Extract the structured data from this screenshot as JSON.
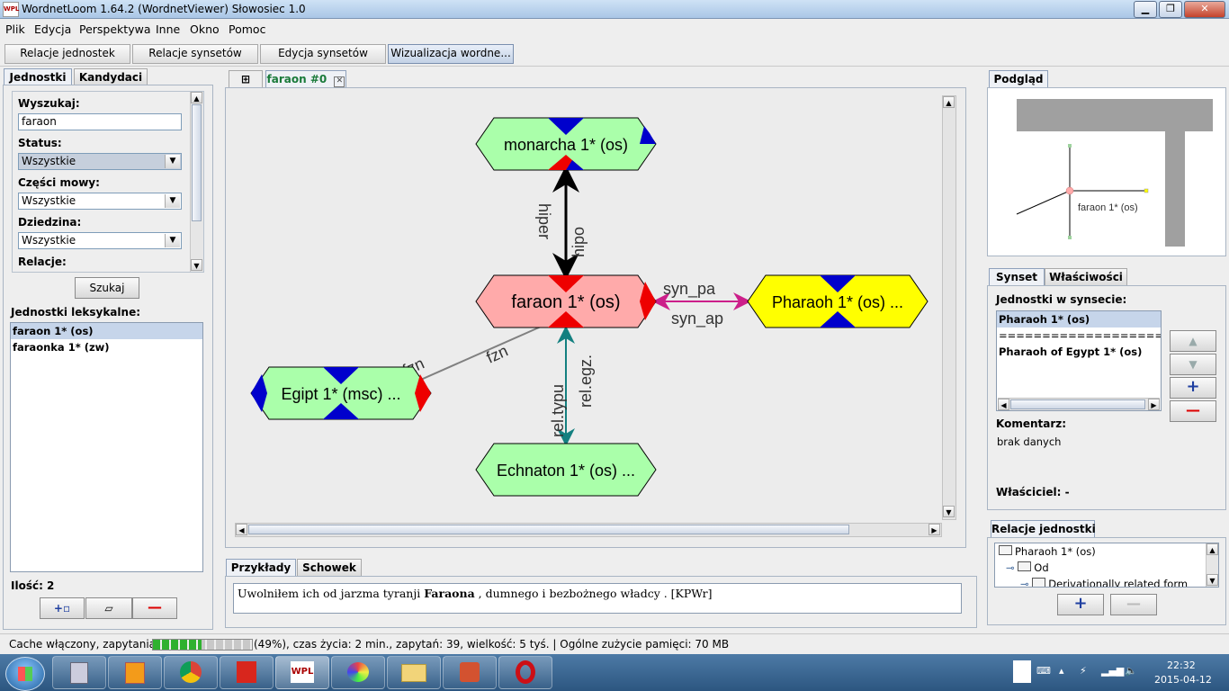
{
  "window": {
    "title": "WordnetLoom 1.64.2 (WordnetViewer) Słowosiec 1.0",
    "app_icon": "WPL"
  },
  "menu": [
    "Plik",
    "Edycja",
    "Perspektywa",
    "Inne",
    "Okno",
    "Pomoc"
  ],
  "perspectives": [
    "Relacje jednostek",
    "Relacje synsetów",
    "Edycja synsetów",
    "Wizualizacja wordne..."
  ],
  "left_panel": {
    "tabs": [
      "Jednostki",
      "Kandydaci"
    ],
    "search_label": "Wyszukaj:",
    "search_value": "faraon",
    "status_label": "Status:",
    "status_value": "Wszystkie",
    "pos_label": "Części mowy:",
    "pos_value": "Wszystkie",
    "domain_label": "Dziedzina:",
    "domain_value": "Wszystkie",
    "relations_label": "Relacje:",
    "search_button": "Szukaj",
    "units_label": "Jednostki leksykalne:",
    "units": [
      "faraon 1* (os)",
      "faraonka 1* (zw)"
    ],
    "count_label": "Ilość: 2"
  },
  "graph": {
    "tab_label": "faraon #0",
    "nodes": {
      "monarcha": "monarcha 1* (os)",
      "faraon": "faraon 1* (os)",
      "pharaoh": "Pharaoh 1* (os) ...",
      "egipt": "Egipt 1* (msc) ...",
      "echnaton": "Echnaton 1* (os) ..."
    },
    "edges": {
      "hiper": "hiper",
      "hipo": "hipo",
      "syn_pa": "syn_pa",
      "syn_ap": "syn_ap",
      "fzn_1": "fzn",
      "fzn_2": "fzn",
      "rel_typu": "rel.typu",
      "rel_egz": "rel.egz."
    },
    "colors": {
      "node_green": "#aaffaa",
      "node_pink": "#ffaaaa",
      "node_yellow": "#ffff00",
      "marker_blue": "#0000cc",
      "marker_red": "#ee0000",
      "edge_syn": "#cc1f8a",
      "edge_type": "#138080"
    }
  },
  "examples": {
    "tabs": [
      "Przykłady",
      "Schowek"
    ],
    "text_before": "Uwolniłem ich od jarzma tyranji ",
    "text_bold": "Faraona",
    "text_after": " , dumnego i bezbożnego władcy . [KPWr]"
  },
  "preview": {
    "tab": "Podgląd",
    "node_label": "faraon 1* (os)"
  },
  "synset_panel": {
    "tabs": [
      "Synset",
      "Właściwości"
    ],
    "units_label": "Jednostki w synsecie:",
    "units": [
      "Pharaoh 1* (os)",
      "==========================================",
      "Pharaoh of Egypt 1* (os)"
    ],
    "comment_label": "Komentarz:",
    "comment_value": "brak danych",
    "owner_label": "Właściciel: -"
  },
  "unit_relations": {
    "tab": "Relacje jednostki",
    "tree": [
      "Pharaoh 1* (os)",
      "Od",
      "Derivationally related form"
    ]
  },
  "status": {
    "text_before": "Cache włączony, zapytania:",
    "text_after": "(49%), czas życia: 2 min., zapytań: 39, wielkość: 5 tyś. | Ogólne zużycie pamięci: 70 MB",
    "cache_progress": 0.49
  },
  "clock": {
    "time": "22:32",
    "date": "2015-04-12"
  }
}
